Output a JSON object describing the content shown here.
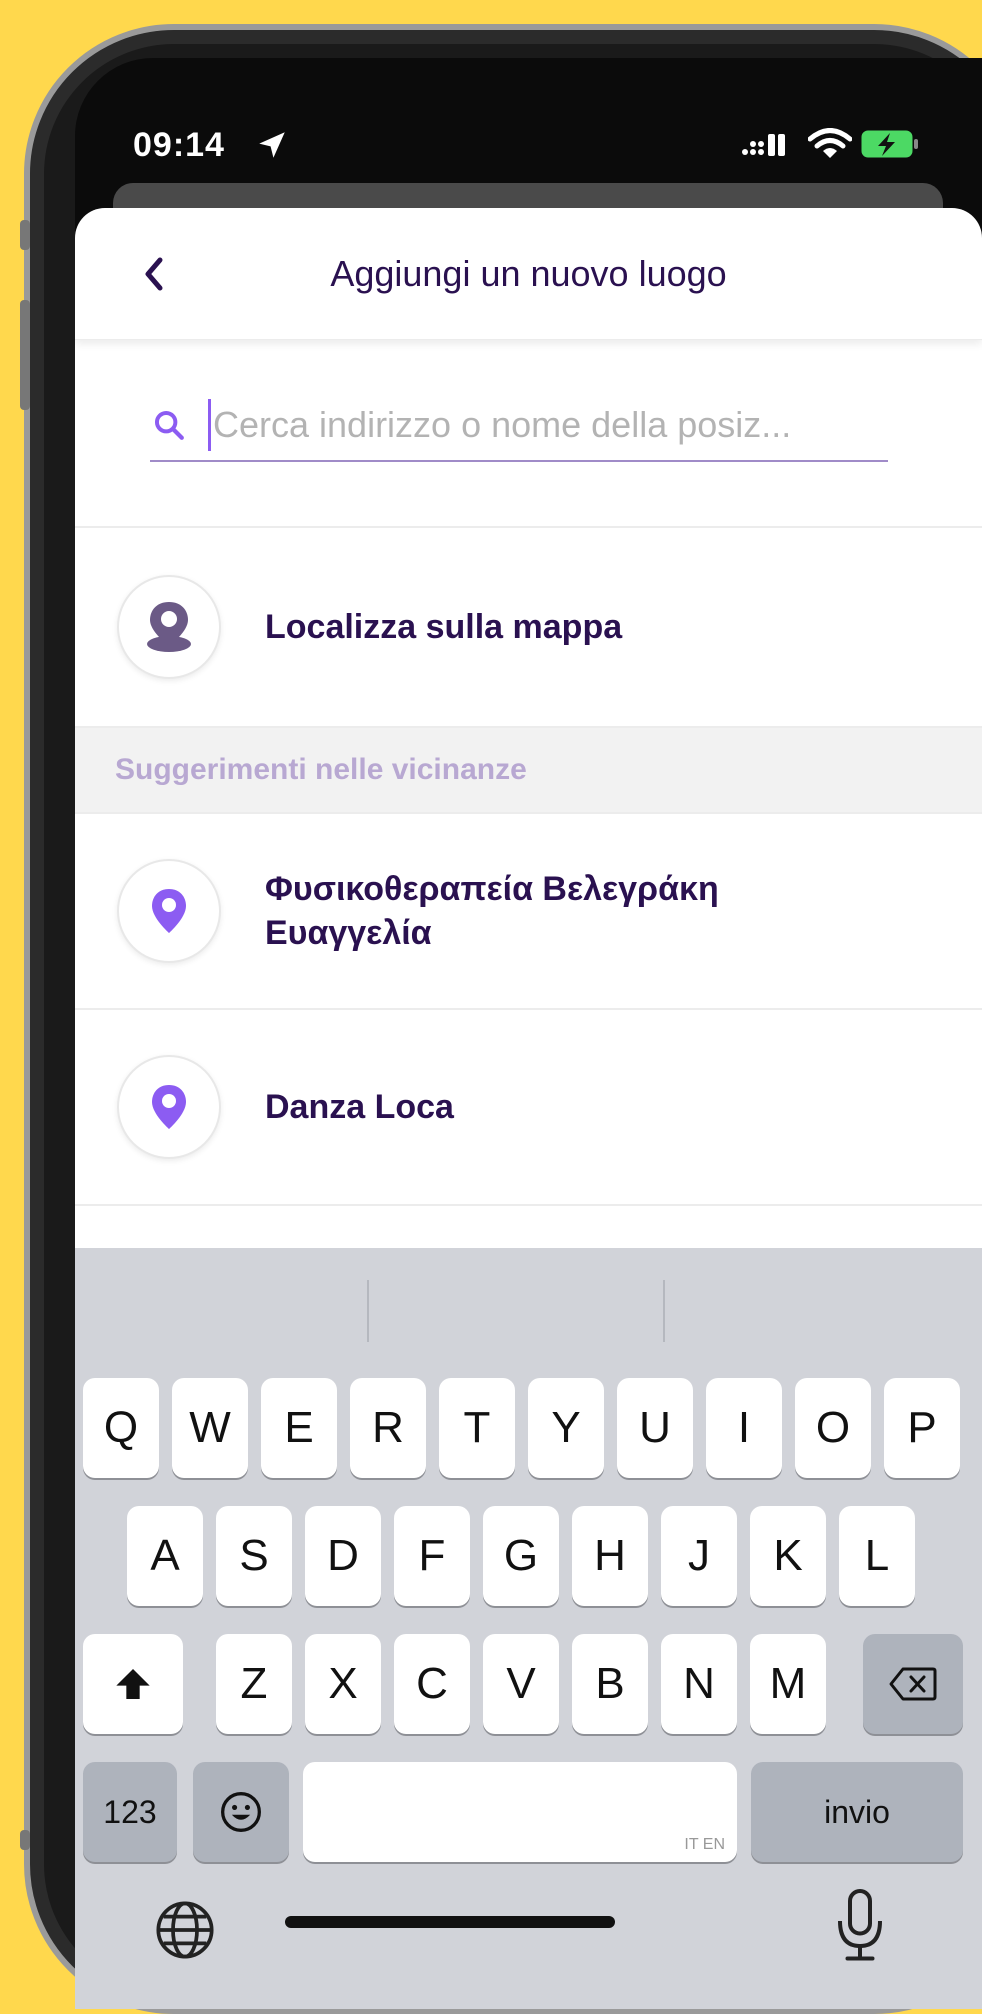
{
  "status": {
    "time": "09:14"
  },
  "header": {
    "title": "Aggiungi un nuovo luogo"
  },
  "search": {
    "placeholder": "Cerca indirizzo o nome della posiz..."
  },
  "locate": {
    "label": "Localizza sulla mappa"
  },
  "suggestions": {
    "heading": "Suggerimenti nelle vicinanze",
    "items": [
      {
        "label": "Φυσικοθεραπεία Βελεγράκη Ευαγγελία"
      },
      {
        "label": "Danza Loca"
      }
    ]
  },
  "keyboard": {
    "row1": [
      "Q",
      "W",
      "E",
      "R",
      "T",
      "Y",
      "U",
      "I",
      "O",
      "P"
    ],
    "row2": [
      "A",
      "S",
      "D",
      "F",
      "G",
      "H",
      "J",
      "K",
      "L"
    ],
    "row3": [
      "Z",
      "X",
      "C",
      "V",
      "B",
      "N",
      "M"
    ],
    "numbers_label": "123",
    "return_label": "invio",
    "space_hint": "IT EN"
  },
  "colors": {
    "accent": "#8C5CF2",
    "title": "#2A1150",
    "background": "#FFD84D"
  },
  "icons": [
    "location-arrow-icon",
    "signal-icon",
    "wifi-icon",
    "battery-charging-icon",
    "back-chevron-icon",
    "search-icon",
    "map-pin-person-icon",
    "map-pin-icon",
    "shift-icon",
    "backspace-icon",
    "emoji-icon",
    "globe-icon",
    "microphone-icon"
  ]
}
